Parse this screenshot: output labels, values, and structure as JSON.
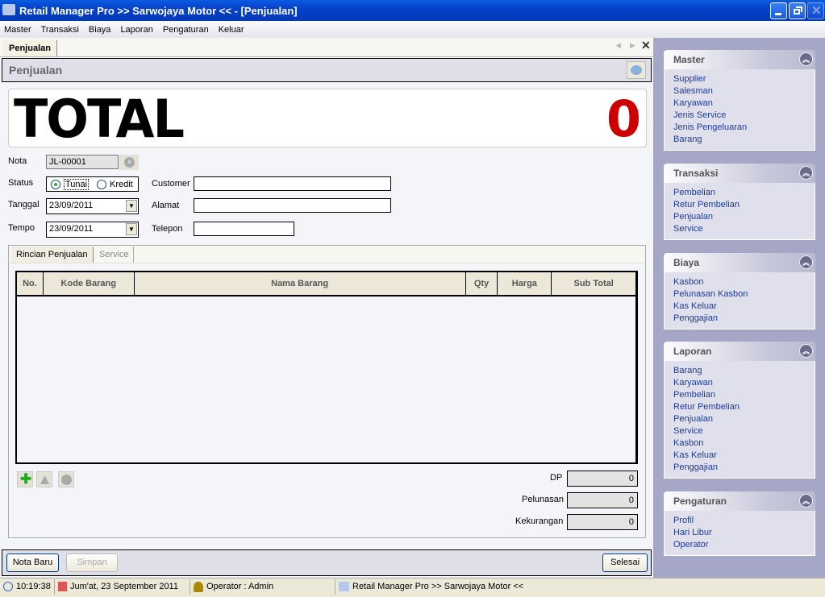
{
  "window": {
    "title": "Retail Manager Pro >> Sarwojaya Motor << - [Penjualan]"
  },
  "menu": [
    "Master",
    "Transaksi",
    "Biaya",
    "Laporan",
    "Pengaturan",
    "Keluar"
  ],
  "doc_tab": "Penjualan",
  "header": {
    "title": "Penjualan"
  },
  "total": {
    "label": "TOTAL",
    "value": "0",
    "value_color": "#cc0000"
  },
  "form": {
    "nota_label": "Nota",
    "nota_value": "JL-00001",
    "status_label": "Status",
    "status_options": [
      "Tunai",
      "Kredit"
    ],
    "status_selected": "Tunai",
    "tanggal_label": "Tanggal",
    "tanggal_value": "23/09/2011",
    "tempo_label": "Tempo",
    "tempo_value": "23/09/2011",
    "customer_label": "Customer",
    "customer_value": "",
    "alamat_label": "Alamat",
    "alamat_value": "",
    "telepon_label": "Telepon",
    "telepon_value": ""
  },
  "tabs": [
    "Rincian Penjualan",
    "Service"
  ],
  "grid": {
    "columns": [
      "No.",
      "Kode Barang",
      "Nama Barang",
      "Qty",
      "Harga",
      "Sub Total"
    ],
    "rows": []
  },
  "summary": {
    "dp_label": "DP",
    "dp_value": "0",
    "pelunasan_label": "Pelunasan",
    "pelunasan_value": "0",
    "kekurangan_label": "Kekurangan",
    "kekurangan_value": "0"
  },
  "buttons": {
    "nota_baru": "Nota Baru",
    "simpan": "Simpan",
    "selesai": "Selesai"
  },
  "status": {
    "time": "10:19:38",
    "date": "Jum'at, 23 September 2011",
    "operator": "Operator : Admin",
    "app": "Retail Manager Pro >> Sarwojaya Motor <<"
  },
  "sidebar": [
    {
      "title": "Master",
      "items": [
        "Supplier",
        "Salesman",
        "Karyawan",
        "Jenis Service",
        "Jenis Pengeluaran",
        "Barang"
      ]
    },
    {
      "title": "Transaksi",
      "items": [
        "Pembelian",
        "Retur Pembelian",
        "Penjualan",
        "Service"
      ]
    },
    {
      "title": "Biaya",
      "items": [
        "Kasbon",
        "Pelunasan Kasbon",
        "Kas Keluar",
        "Penggajian"
      ]
    },
    {
      "title": "Laporan",
      "items": [
        "Barang",
        "Karyawan",
        "Pembelian",
        "Retur Pembelian",
        "Penjualan",
        "Service",
        "Kasbon",
        "Kas Keluar",
        "Penggajian"
      ]
    },
    {
      "title": "Pengaturan",
      "items": [
        "Profil",
        "Hari Libur",
        "Operator"
      ]
    }
  ]
}
